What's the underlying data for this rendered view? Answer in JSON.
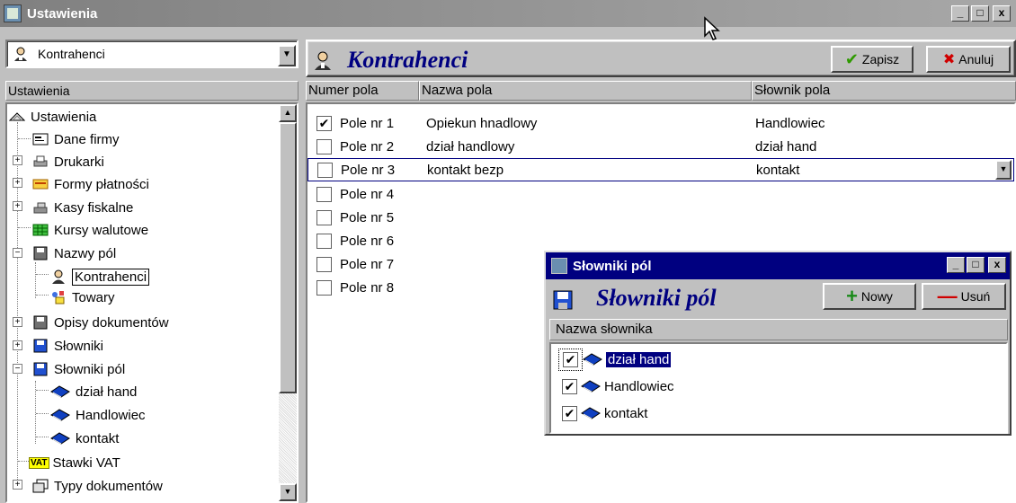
{
  "window": {
    "title": "Ustawienia",
    "minimize": "_",
    "maximize": "□",
    "close": "x"
  },
  "left": {
    "combo_value": "Kontrahenci",
    "tree_header": "Ustawienia",
    "tree_items": [
      "Ustawienia",
      "Dane firmy",
      "Drukarki",
      "Formy płatności",
      "Kasy fiskalne",
      "Kursy walutowe",
      "Nazwy pól",
      "Kontrahenci",
      "Towary",
      "Opisy dokumentów",
      "Słowniki",
      "Słowniki pól",
      "dział hand",
      "Handlowiec",
      "kontakt",
      "Stawki VAT",
      "Typy dokumentów"
    ],
    "vat_badge": "VAT"
  },
  "right": {
    "title": "Kontrahenci",
    "save_label": "Zapisz",
    "cancel_label": "Anuluj",
    "columns": [
      "Numer pola",
      "Nazwa pola",
      "Słownik pola"
    ],
    "rows": [
      {
        "checked": true,
        "num": "Pole nr 1",
        "name": "Opiekun hnadlowy",
        "dict": "Handlowiec"
      },
      {
        "checked": false,
        "num": "Pole nr 2",
        "name": "dział handlowy",
        "dict": "dział hand"
      },
      {
        "checked": false,
        "num": "Pole nr 3",
        "name": "kontakt bezp",
        "dict": "kontakt"
      },
      {
        "checked": false,
        "num": "Pole nr 4",
        "name": "",
        "dict": ""
      },
      {
        "checked": false,
        "num": "Pole nr 5",
        "name": "",
        "dict": ""
      },
      {
        "checked": false,
        "num": "Pole nr 6",
        "name": "",
        "dict": ""
      },
      {
        "checked": false,
        "num": "Pole nr 7",
        "name": "",
        "dict": ""
      },
      {
        "checked": false,
        "num": "Pole nr 8",
        "name": "",
        "dict": ""
      }
    ]
  },
  "dialog": {
    "title": "Słowniki pól",
    "header": "Słowniki pól",
    "new_label": "Nowy",
    "delete_label": "Usuń",
    "column": "Nazwa słownika",
    "items": [
      {
        "checked": true,
        "label": "dział hand"
      },
      {
        "checked": true,
        "label": "Handlowiec"
      },
      {
        "checked": true,
        "label": "kontakt"
      }
    ]
  },
  "colors": {
    "title_active": "#000080",
    "title_inactive": "#808080",
    "header_text": "#000080",
    "save_check": "#2e9a00",
    "cancel_x": "#d00000",
    "new_plus": "#1a8a1a",
    "delete_minus": "#d00000"
  }
}
